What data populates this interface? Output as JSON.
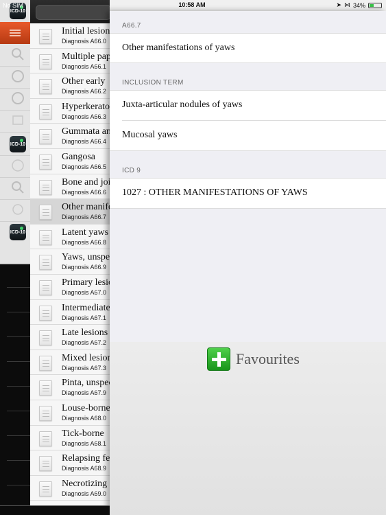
{
  "status_bar": {
    "carrier": "No SIM",
    "time": "10:58 AM",
    "battery_text": "34%",
    "battery_level": 0.34
  },
  "app_icon_label": "ICD-10",
  "list": [
    {
      "title": "Initial lesions",
      "sub": "Diagnosis A66.0"
    },
    {
      "title": "Multiple papillomata",
      "sub": "Diagnosis A66.1"
    },
    {
      "title": "Other early",
      "sub": "Diagnosis A66.2"
    },
    {
      "title": "Hyperkeratosis",
      "sub": "Diagnosis A66.3"
    },
    {
      "title": "Gummata and",
      "sub": "Diagnosis A66.4"
    },
    {
      "title": "Gangosa",
      "sub": "Diagnosis A66.5"
    },
    {
      "title": "Bone and joint",
      "sub": "Diagnosis A66.6"
    },
    {
      "title": "Other manifestations",
      "sub": "Diagnosis A66.7"
    },
    {
      "title": "Latent yaws",
      "sub": "Diagnosis A66.8"
    },
    {
      "title": "Yaws, unspecified",
      "sub": "Diagnosis A66.9"
    },
    {
      "title": "Primary lesions",
      "sub": "Diagnosis A67.0"
    },
    {
      "title": "Intermediate",
      "sub": "Diagnosis A67.1"
    },
    {
      "title": "Late lesions",
      "sub": "Diagnosis A67.2"
    },
    {
      "title": "Mixed lesions",
      "sub": "Diagnosis A67.3"
    },
    {
      "title": "Pinta, unspecified",
      "sub": "Diagnosis A67.9"
    },
    {
      "title": "Louse-borne",
      "sub": "Diagnosis A68.0"
    },
    {
      "title": "Tick-borne",
      "sub": "Diagnosis A68.1"
    },
    {
      "title": "Relapsing fever",
      "sub": "Diagnosis A68.9"
    },
    {
      "title": "Necrotizing",
      "sub": "Diagnosis A69.0"
    }
  ],
  "selected_index": 7,
  "detail": {
    "code_header": "A66.7",
    "code_title": "Other manifestations of yaws",
    "inclusion_header": "INCLUSION TERM",
    "inclusion_terms": [
      "Juxta-articular nodules of yaws",
      "Mucosal yaws"
    ],
    "icd9_header": "ICD 9",
    "icd9_value": "1027 : OTHER MANIFESTATIONS OF YAWS"
  },
  "favourites_label": "Favourites"
}
